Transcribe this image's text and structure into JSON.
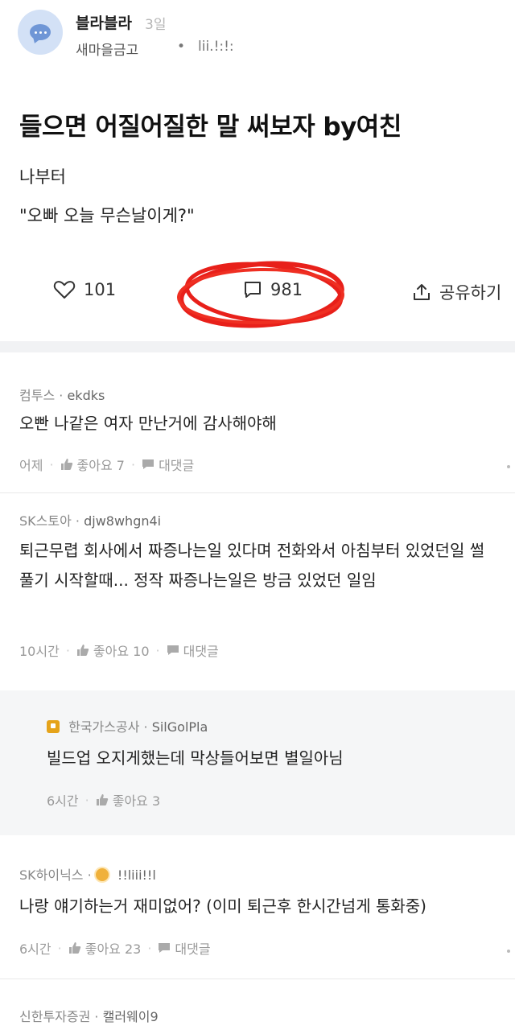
{
  "post": {
    "author": "블라블라",
    "time": "3일",
    "company": "새마을금고",
    "meta_sep": "•",
    "nickname": "lii.!:!:",
    "title": "들으면 어질어질한 말 써보자 by여친",
    "body_line1": "나부터",
    "body_line2": "\"오빠 오늘 무슨날이게?\""
  },
  "actions": {
    "likes": "101",
    "comments": "981",
    "share_label": "공유하기"
  },
  "comments": [
    {
      "company": "컴투스",
      "nickname": "ekdks",
      "text": "오빤 나같은 여자 만난거에 감사해야해",
      "time": "어제",
      "likes_label": "좋아요 7",
      "reply_label": "대댓글"
    },
    {
      "company": "SK스토아",
      "nickname": "djw8whgn4i",
      "text": "퇴근무렵 회사에서 짜증나는일 있다며 전화와서 아침부터 있었던일 썰 풀기 시작할때... 정작 짜증나는일은 방금 있었던 일임",
      "time": "10시간",
      "likes_label": "좋아요 10",
      "reply_label": "대댓글"
    },
    {
      "company": "SK하이닉스",
      "nickname": "!!liii!!l",
      "text": "나랑 얘기하는거 재미없어? (이미 퇴근후 한시간넘게 통화중)",
      "time": "6시간",
      "likes_label": "좋아요 23",
      "reply_label": "대댓글"
    },
    {
      "company": "신한투자증권",
      "nickname": "캘러웨이9"
    }
  ],
  "reply": {
    "company": "한국가스공사",
    "nickname": "SilGolPla",
    "text": "빌드업 오지게했는데 막상들어보면 별일아님",
    "time": "6시간",
    "likes_label": "좋아요 3"
  },
  "meta_dot": "·",
  "colors": {
    "accent": "#6f96d6",
    "annotation": "#e8201a",
    "divider": "#f1f2f4"
  }
}
